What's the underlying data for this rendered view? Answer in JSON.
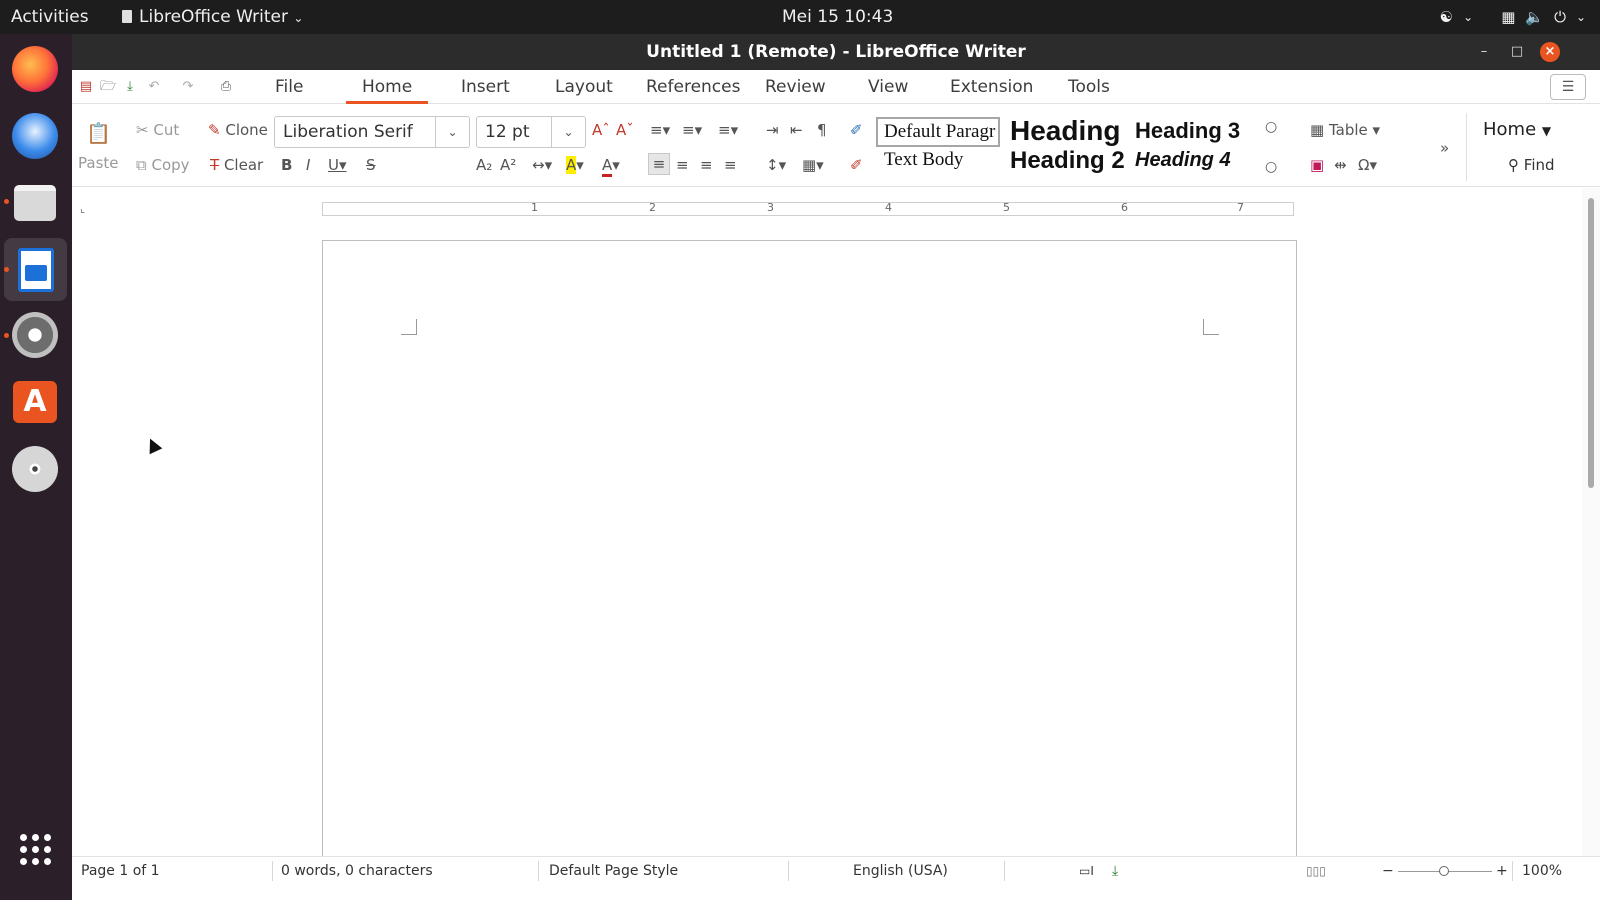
{
  "topbar": {
    "activities": "Activities",
    "app_name": "LibreOffice Writer",
    "clock": "Mei 15  10:43"
  },
  "window": {
    "title": "Untitled 1 (Remote) - LibreOffice Writer"
  },
  "menu_tabs": [
    "File",
    "Home",
    "Insert",
    "Layout",
    "References",
    "Review",
    "View",
    "Extension",
    "Tools"
  ],
  "active_tab": "Home",
  "ribbon": {
    "paste": "Paste",
    "cut": "Cut",
    "copy": "Copy",
    "clone": "Clone",
    "clear": "Clear",
    "font_name": "Liberation Serif",
    "font_size": "12 pt",
    "styles": {
      "default_paragraph": "Default Paragr",
      "text_body": "Text Body",
      "heading1": "Heading",
      "heading2": "Heading 2",
      "heading3": "Heading 3",
      "heading4": "Heading 4"
    },
    "table": "Table",
    "find": "Find",
    "home_dropdown": "Home"
  },
  "ruler": {
    "numbers": [
      "1",
      "2",
      "3",
      "4",
      "5",
      "6",
      "7"
    ]
  },
  "statusbar": {
    "page": "Page 1 of 1",
    "words": "0 words, 0 characters",
    "page_style": "Default Page Style",
    "language": "English (USA)",
    "zoom": "100%"
  },
  "colors": {
    "accent": "#e95420",
    "dock_bg": "#2b1f2a",
    "topbar_bg": "#1d1d1d",
    "titlebar_bg": "#2c2c2c"
  }
}
